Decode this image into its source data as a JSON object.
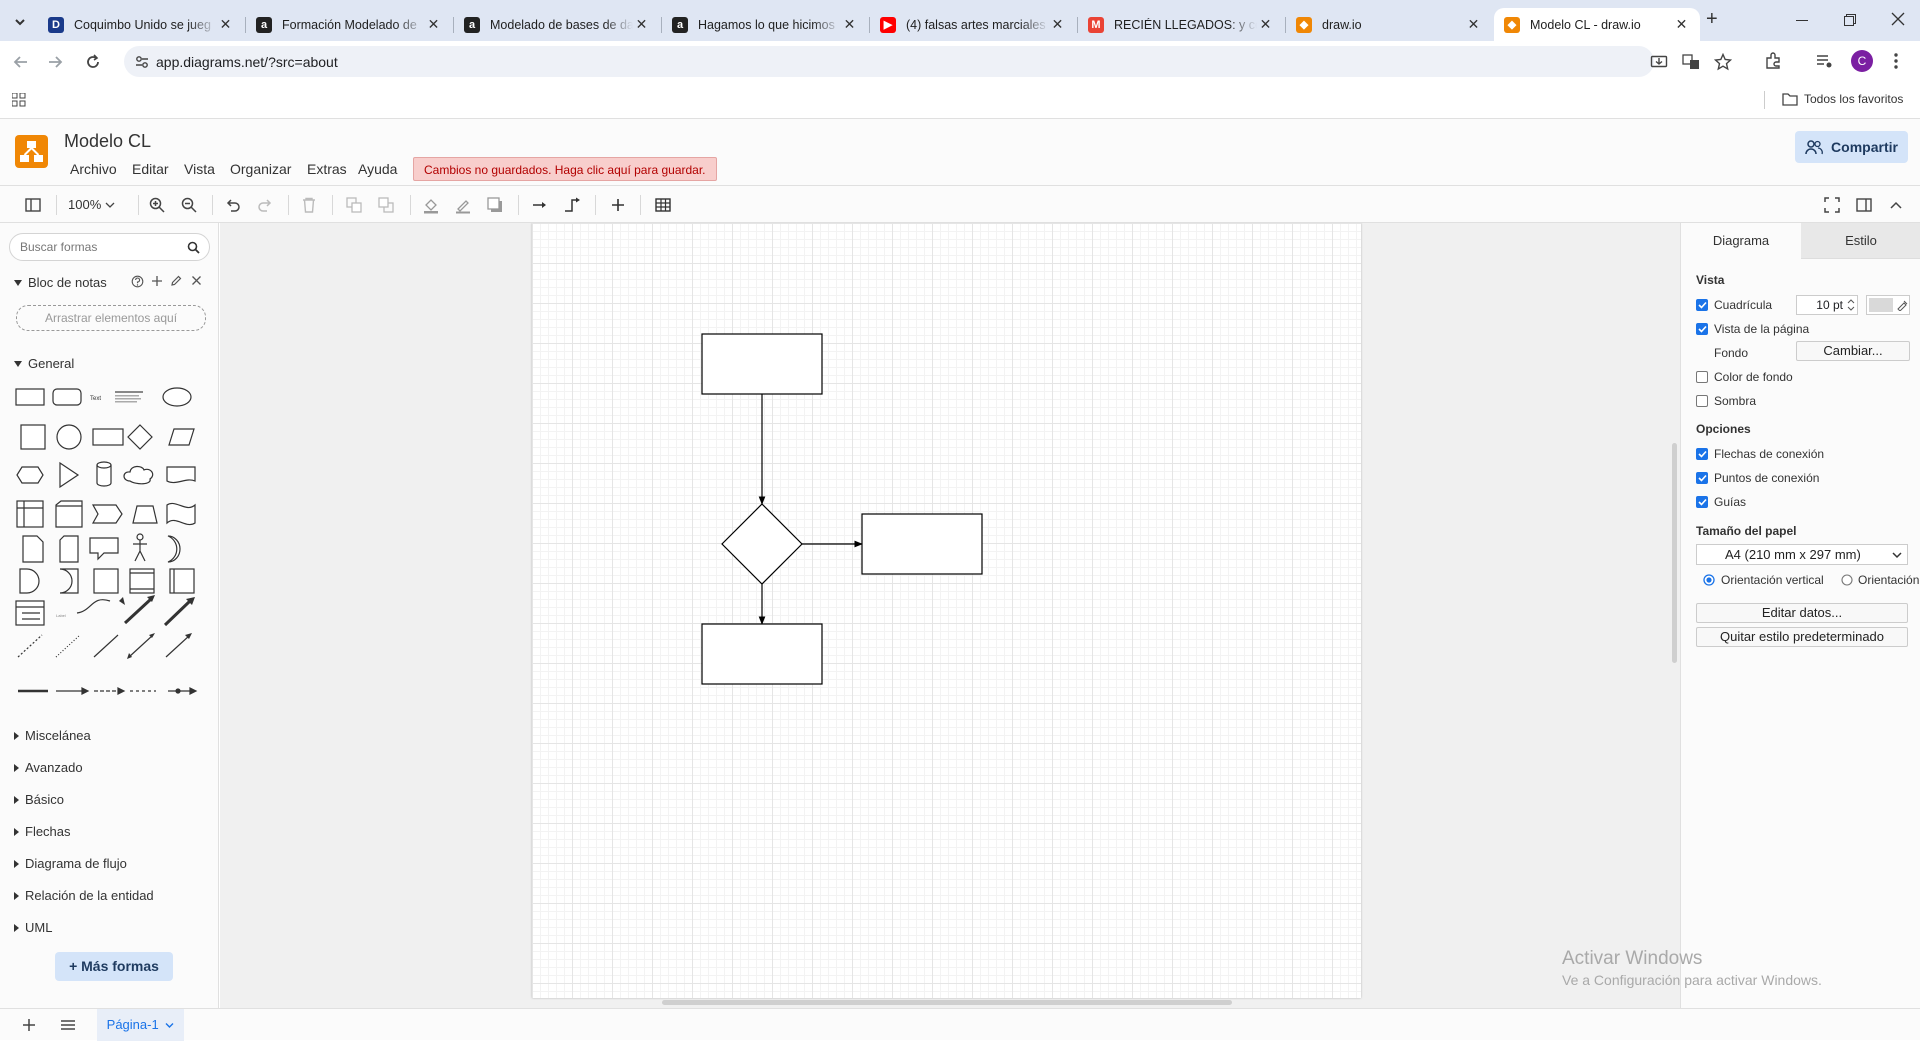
{
  "browser": {
    "tabs": [
      {
        "title": "Coquimbo Unido se jueg",
        "favicon": "D",
        "color": "#1a3a8a"
      },
      {
        "title": "Formación Modelado de",
        "favicon": "a",
        "color": "#222222"
      },
      {
        "title": "Modelado de bases de da",
        "favicon": "a",
        "color": "#222222"
      },
      {
        "title": "Hagamos lo que hicimos",
        "favicon": "a",
        "color": "#222222"
      },
      {
        "title": "(4) falsas artes marciales",
        "favicon": "▶",
        "color": "#ff0000"
      },
      {
        "title": "RECIÉN LLEGADOS: y con",
        "favicon": "M",
        "color": "#ea4335"
      },
      {
        "title": "draw.io",
        "favicon": "◆",
        "color": "#f08705"
      },
      {
        "title": "Modelo CL - draw.io",
        "favicon": "◆",
        "color": "#f08705"
      }
    ],
    "url": "app.diagrams.net/?src=about",
    "bookmarks_label": "Todos los favoritos",
    "profile_initial": "C"
  },
  "app": {
    "title": "Modelo CL",
    "menus": [
      "Archivo",
      "Editar",
      "Vista",
      "Organizar",
      "Extras",
      "Ayuda"
    ],
    "unsaved_notice": "Cambios no guardados. Haga clic aquí para guardar.",
    "share_label": "Compartir",
    "zoom": "100%"
  },
  "left_panel": {
    "search_placeholder": "Buscar formas",
    "scratchpad_title": "Bloc de notas",
    "drop_hint": "Arrastrar elementos aquí",
    "general_title": "General",
    "categories": [
      "Miscelánea",
      "Avanzado",
      "Básico",
      "Flechas",
      "Diagrama de flujo",
      "Relación de la entidad",
      "UML"
    ],
    "more_shapes": "+ Más formas"
  },
  "right_panel": {
    "tab_diagram": "Diagrama",
    "tab_style": "Estilo",
    "view_title": "Vista",
    "grid_label": "Cuadrícula",
    "grid_size": "10 pt",
    "page_view_label": "Vista de la página",
    "background_label": "Fondo",
    "change_label": "Cambiar...",
    "bg_color_label": "Color de fondo",
    "shadow_label": "Sombra",
    "options_title": "Opciones",
    "conn_arrows_label": "Flechas de conexión",
    "conn_points_label": "Puntos de conexión",
    "guides_label": "Guías",
    "paper_size_title": "Tamaño del papel",
    "paper_size": "A4 (210 mm x 297 mm)",
    "portrait_label": "Orientación vertical",
    "landscape_label": "Orientación",
    "edit_data_label": "Editar datos...",
    "clear_style_label": "Quitar estilo predeterminado"
  },
  "bottom": {
    "page_tab": "Página-1"
  },
  "watermark": {
    "line1": "Activar Windows",
    "line2": "Ve a Configuración para activar Windows."
  }
}
